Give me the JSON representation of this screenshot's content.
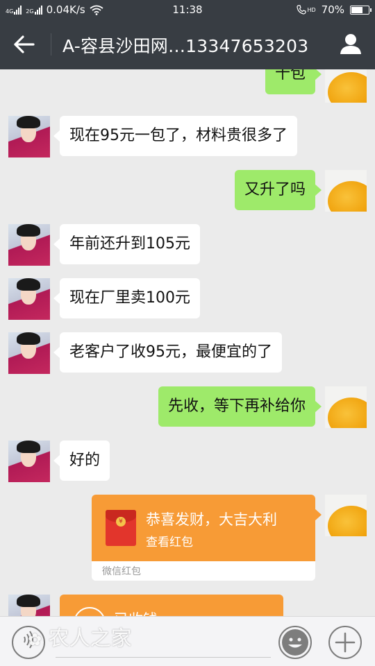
{
  "status_bar": {
    "network_type_1": "4G",
    "network_type_2": "2G",
    "speed": "0.04K/s",
    "time": "11:38",
    "hd": "HD",
    "battery_percent": "70%",
    "battery_level": 0.7
  },
  "header": {
    "title": "A-容县沙田网…13347653203",
    "back_icon": "arrow-left-icon",
    "profile_icon": "person-icon"
  },
  "messages": [
    {
      "from": "self",
      "text": "十包"
    },
    {
      "from": "other",
      "text": "现在95元一包了，材料贵很多了"
    },
    {
      "from": "self",
      "text": "又升了吗"
    },
    {
      "from": "other",
      "text": "年前还升到105元"
    },
    {
      "from": "other",
      "text": "现在厂里卖100元"
    },
    {
      "from": "other",
      "text": "老客户了收95元，最便宜的了"
    },
    {
      "from": "self",
      "text": "先收，等下再补给你"
    },
    {
      "from": "other",
      "text": "好的"
    }
  ],
  "red_packet": {
    "from": "self",
    "title": "恭喜发财，大吉大利",
    "subtitle": "查看红包",
    "footer": "微信红包",
    "coin_symbol": "¥",
    "color": "#f79b36"
  },
  "received_packet": {
    "from": "other",
    "label": "已收钱"
  },
  "bottom_bar": {
    "watermark": "农人之家",
    "voice_icon": "voice-icon",
    "emoji_icon": "emoji-icon",
    "plus_icon": "plus-icon"
  },
  "colors": {
    "header_bg": "#383d43",
    "chat_bg": "#ebebeb",
    "self_bubble": "#9eea6a",
    "other_bubble": "#ffffff"
  }
}
